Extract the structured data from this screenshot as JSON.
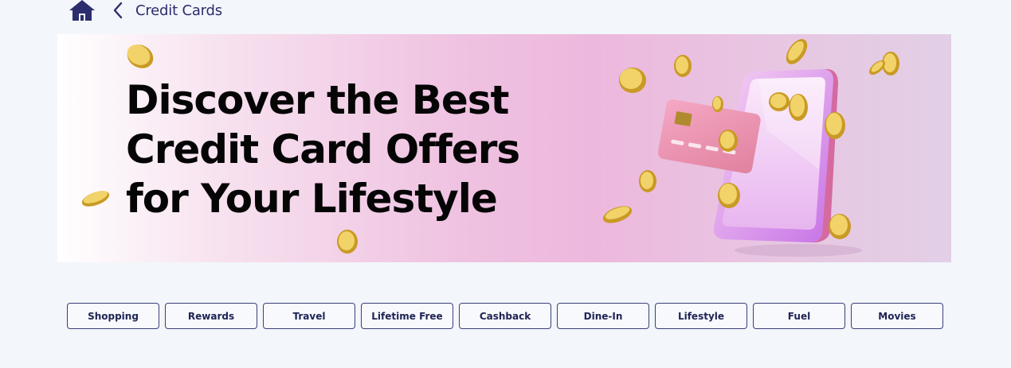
{
  "header": {
    "home_icon": "home-icon",
    "back_icon": "chevron-left-icon",
    "title": "Credit Cards"
  },
  "banner": {
    "headline_lines": [
      "Discover the Best",
      "Credit Card Offers",
      "for Your Lifestyle"
    ],
    "illustration": "phone-with-credit-card-and-coins"
  },
  "tabs": [
    {
      "label": "Shopping"
    },
    {
      "label": "Rewards"
    },
    {
      "label": "Travel"
    },
    {
      "label": "Lifetime Free"
    },
    {
      "label": "Cashback"
    },
    {
      "label": "Dine-In"
    },
    {
      "label": "Lifestyle"
    },
    {
      "label": "Fuel"
    },
    {
      "label": "Movies"
    }
  ],
  "colors": {
    "page_bg": "#f3f6fa",
    "accent": "#2b2d6e",
    "banner_pink": "#edb8dd",
    "coin_gold": "#e7c24a"
  }
}
